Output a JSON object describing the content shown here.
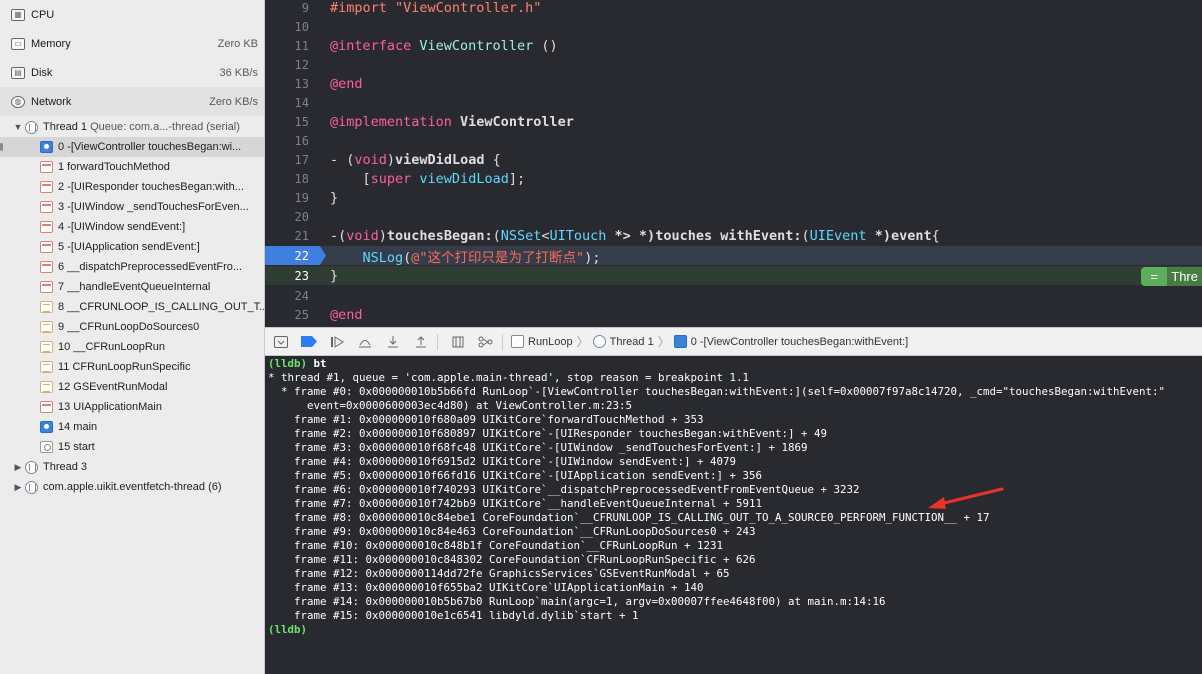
{
  "sidebar": {
    "gauges": [
      {
        "name": "CPU",
        "value": ""
      },
      {
        "name": "Memory",
        "value": "Zero KB"
      },
      {
        "name": "Disk",
        "value": "36 KB/s"
      },
      {
        "name": "Network",
        "value": "Zero KB/s"
      }
    ],
    "thread1_label": "Thread 1",
    "thread1_queue": "Queue: com.a...-thread (serial)",
    "frames": [
      {
        "label": "0 -[ViewController touchesBegan:wi...",
        "icon": "user"
      },
      {
        "label": "1 forwardTouchMethod",
        "icon": "sys"
      },
      {
        "label": "2 -[UIResponder touchesBegan:with...",
        "icon": "sys"
      },
      {
        "label": "3 -[UIWindow _sendTouchesForEven...",
        "icon": "sys"
      },
      {
        "label": "4 -[UIWindow sendEvent:]",
        "icon": "sys"
      },
      {
        "label": "5 -[UIApplication sendEvent:]",
        "icon": "sys"
      },
      {
        "label": "6 __dispatchPreprocessedEventFro...",
        "icon": "sys"
      },
      {
        "label": "7 __handleEventQueueInternal",
        "icon": "sys"
      },
      {
        "label": "8 __CFRUNLOOP_IS_CALLING_OUT_T...",
        "icon": "cf"
      },
      {
        "label": "9 __CFRunLoopDoSources0",
        "icon": "cf"
      },
      {
        "label": "10 __CFRunLoopRun",
        "icon": "cf"
      },
      {
        "label": "11 CFRunLoopRunSpecific",
        "icon": "cf"
      },
      {
        "label": "12 GSEventRunModal",
        "icon": "cf"
      },
      {
        "label": "13 UIApplicationMain",
        "icon": "sys"
      },
      {
        "label": "14 main",
        "icon": "user"
      },
      {
        "label": "15 start",
        "icon": "gear"
      }
    ],
    "thread3_label": "Thread 3",
    "eventfetch_label": "com.apple.uikit.eventfetch-thread (6)"
  },
  "editor": {
    "line_numbers": [
      "9",
      "10",
      "11",
      "12",
      "13",
      "14",
      "15",
      "16",
      "17",
      "18",
      "19",
      "20",
      "21",
      "22",
      "23",
      "24",
      "25"
    ],
    "l9_pre": "#import ",
    "l9_str": "\"ViewController.h\"",
    "l11_kw": "@interface ",
    "l11_cls": "ViewController ",
    "l11_rest": "()",
    "l13_kw": "@end",
    "l15_kw": "@implementation ",
    "l15_cls": "ViewController",
    "l17_a": "- (",
    "l17_void": "void",
    "l17_b": ")",
    "l17_name": "viewDidLoad",
    "l17_c": " {",
    "l18_a": "    [",
    "l18_super": "super",
    "l18_sp": " ",
    "l18_call": "viewDidLoad",
    "l18_b": "];",
    "l19": "}",
    "l21_a": "-(",
    "l21_void": "void",
    "l21_b": ")",
    "l21_name": "touchesBegan:",
    "l21_c": "(",
    "l21_nsset": "NSSet",
    "l21_lt": "<",
    "l21_uitouch": "UITouch",
    "l21_d": " *> *)",
    "l21_touches": "touches ",
    "l21_with": "withEvent:",
    "l21_e": "(",
    "l21_uievent": "UIEvent",
    "l21_f": " *)",
    "l21_event": "event",
    "l21_g": "{",
    "l22_ind": "    ",
    "l22_fn": "NSLog",
    "l22_a": "(",
    "l22_str": "@\"这个打印只是为了打断点\"",
    "l22_b": ");",
    "l23": "}",
    "l25_kw": "@end",
    "badge_icon": "=",
    "badge_text": "Thre"
  },
  "debugbar": {
    "crumb_target": "RunLoop",
    "crumb_thread": "Thread 1",
    "crumb_frame": "0 -[ViewController touchesBegan:withEvent:]"
  },
  "console": {
    "prompt1": "(lldb)",
    "cmd1": " bt",
    "lines": [
      "* thread #1, queue = 'com.apple.main-thread', stop reason = breakpoint 1.1",
      "  * frame #0: 0x000000010b5b66fd RunLoop`-[ViewController touchesBegan:withEvent:](self=0x00007f97a8c14720, _cmd=\"touchesBegan:withEvent:\"",
      "      event=0x0000600003ec4d80) at ViewController.m:23:5",
      "    frame #1: 0x000000010f680a09 UIKitCore`forwardTouchMethod + 353",
      "    frame #2: 0x000000010f680897 UIKitCore`-[UIResponder touchesBegan:withEvent:] + 49",
      "    frame #3: 0x000000010f68fc48 UIKitCore`-[UIWindow _sendTouchesForEvent:] + 1869",
      "    frame #4: 0x000000010f6915d2 UIKitCore`-[UIWindow sendEvent:] + 4079",
      "    frame #5: 0x000000010f66fd16 UIKitCore`-[UIApplication sendEvent:] + 356",
      "    frame #6: 0x000000010f740293 UIKitCore`__dispatchPreprocessedEventFromEventQueue + 3232",
      "    frame #7: 0x000000010f742bb9 UIKitCore`__handleEventQueueInternal + 5911",
      "    frame #8: 0x000000010c84ebe1 CoreFoundation`__CFRUNLOOP_IS_CALLING_OUT_TO_A_SOURCE0_PERFORM_FUNCTION__ + 17",
      "    frame #9: 0x000000010c84e463 CoreFoundation`__CFRunLoopDoSources0 + 243",
      "    frame #10: 0x000000010c848b1f CoreFoundation`__CFRunLoopRun + 1231",
      "    frame #11: 0x000000010c848302 CoreFoundation`CFRunLoopRunSpecific + 626",
      "    frame #12: 0x0000000114dd72fe GraphicsServices`GSEventRunModal + 65",
      "    frame #13: 0x000000010f655ba2 UIKitCore`UIApplicationMain + 140",
      "    frame #14: 0x000000010b5b67b0 RunLoop`main(argc=1, argv=0x00007ffee4648f00) at main.m:14:16",
      "    frame #15: 0x000000010e1c6541 libdyld.dylib`start + 1"
    ],
    "prompt2": "(lldb)"
  },
  "colors": {
    "breakpoint": "#3f7fe0",
    "annotation_arrow": "#e8332a",
    "prompt": "#6ce36c"
  }
}
